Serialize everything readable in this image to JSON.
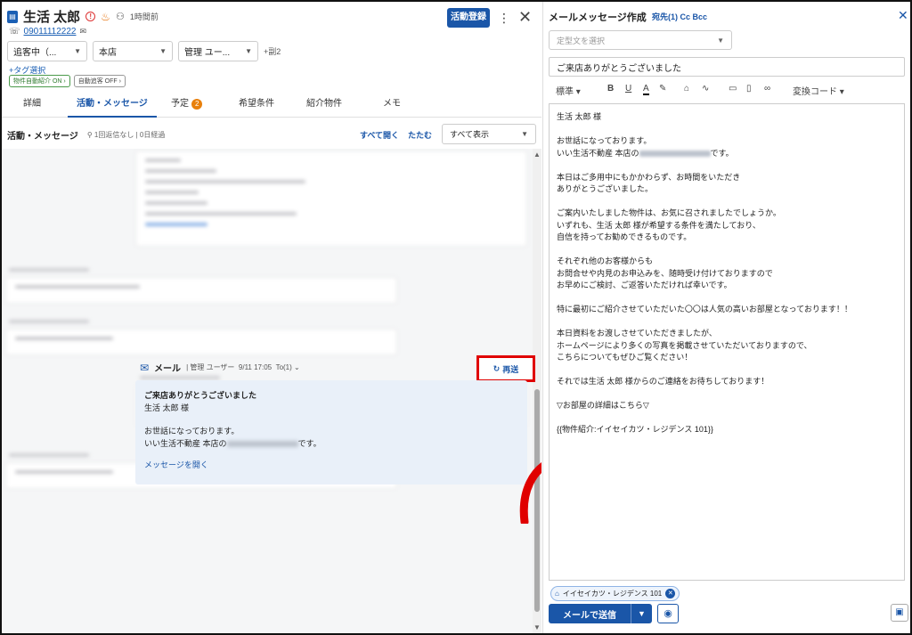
{
  "customer": {
    "name": "生活 太郎",
    "last_active": "1時間前",
    "phone": "09011112222"
  },
  "header": {
    "activity_register": "活動登録"
  },
  "selects": [
    {
      "value": "追客中（..."
    },
    {
      "value": "本店"
    },
    {
      "value": "管理 ユー..."
    }
  ],
  "selects_extra": "+副2",
  "tag_select": "+タグ選択",
  "chips": {
    "auto_intro": "物件自動紹介 ON",
    "auto_follow": "自動追客 OFF"
  },
  "tabs": [
    {
      "label": "詳細"
    },
    {
      "label": "活動・メッセージ"
    },
    {
      "label": "予定",
      "badge": "2"
    },
    {
      "label": "希望条件"
    },
    {
      "label": "紹介物件"
    },
    {
      "label": "メモ"
    }
  ],
  "activity": {
    "title": "活動・メッセージ",
    "reply_status": "1回返信なし",
    "days_passed": "0日経過",
    "open_all": "すべて開く",
    "fold": "たたむ",
    "filter": "すべて表示"
  },
  "mail_item": {
    "label": "メール",
    "author": "管理 ユーザー",
    "datetime": "9/11 17:05",
    "to": "To(1)",
    "resend": "再送",
    "subject": "ご来店ありがとうございました",
    "greeting": "生活 太郎 様",
    "line1": "お世話になっております。",
    "line2": "いい生活不動産 本店の",
    "line2_tail": "です。",
    "open_msg": "メッセージを開く"
  },
  "compose": {
    "title": "メールメッセージ作成",
    "recipients": "宛先(1) Cc Bcc",
    "template_placeholder": "定型文を選択",
    "subject": "ご来店ありがとうございました",
    "toolbar": {
      "style": "標準",
      "convert": "変換コード"
    },
    "body_head": "生活 太郎 様\n\nお世話になっております。\nいい生活不動産 本店の",
    "body_mid": "です。\n\n本日はご多用中にもかかわらず、お時間をいただき\nありがとうございました。\n\nご案内いたしました物件は、お気に召されましたでしょうか。\nいずれも、生活 太郎 様が希望する条件を満たしており、\n自信を持ってお勧めできるものです。\n\nそれぞれ他のお客様からも\nお問合せや内見のお申込みを、随時受け付けておりますので\nお早めにご検討、ご返答いただければ幸いです。\n\n特に最初にご紹介させていただいた〇〇は人気の高いお部屋となっております！！\n\n本日資料をお渡しさせていただきましたが、\nホームページにより多くの写真を掲載させていただいておりますので、\nこちらについてもぜひご覧ください！\n\nそれでは生活 太郎 様からのご連絡をお待ちしております！\n\n▽お部屋の詳細はこちら▽\n\n{{物件紹介:イイセイカツ・レジデンス 101}}",
    "property_chip": "イイセイカツ・レジデンス 101",
    "send": "メールで送信"
  },
  "colors": {
    "primary": "#1a56a8",
    "highlight": "#e00000",
    "badge": "#e8800c"
  }
}
